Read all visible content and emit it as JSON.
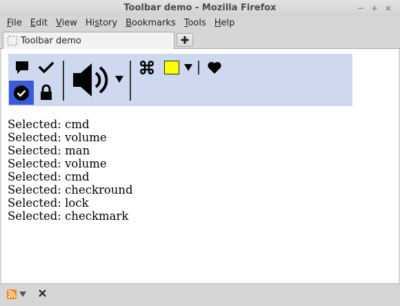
{
  "window": {
    "title": "Toolbar demo - Mozilla Firefox",
    "controls": [
      "−",
      "+",
      "×"
    ]
  },
  "menu": [
    {
      "accel": "F",
      "rest": "ile"
    },
    {
      "accel": "E",
      "rest": "dit"
    },
    {
      "accel": "V",
      "rest": "iew"
    },
    {
      "pre": "Hi",
      "accel": "s",
      "rest": "tory"
    },
    {
      "accel": "B",
      "rest": "ookmarks"
    },
    {
      "accel": "T",
      "rest": "ools"
    },
    {
      "accel": "H",
      "rest": "elp"
    }
  ],
  "tab": {
    "label": "Toolbar demo"
  },
  "toolbar": {
    "buttons": [
      "comment-icon",
      "checkmark-icon",
      "checkround-icon",
      "lock-icon",
      "volume-icon",
      "cmd-icon",
      "color-swatch",
      "heart-icon"
    ],
    "color_swatch": "#ffff00",
    "selected_bg": "#3a5bd9"
  },
  "log": [
    "Selected: cmd",
    "Selected: volume",
    "Selected: man",
    "Selected: volume",
    "Selected: cmd",
    "Selected: checkround",
    "Selected: lock",
    "Selected: checkmark"
  ]
}
